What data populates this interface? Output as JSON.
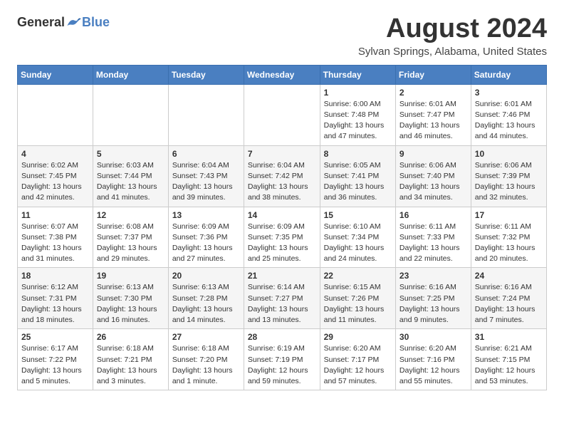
{
  "header": {
    "logo_general": "General",
    "logo_blue": "Blue",
    "month_title": "August 2024",
    "location": "Sylvan Springs, Alabama, United States"
  },
  "days_of_week": [
    "Sunday",
    "Monday",
    "Tuesday",
    "Wednesday",
    "Thursday",
    "Friday",
    "Saturday"
  ],
  "weeks": [
    [
      {
        "day": "",
        "info": ""
      },
      {
        "day": "",
        "info": ""
      },
      {
        "day": "",
        "info": ""
      },
      {
        "day": "",
        "info": ""
      },
      {
        "day": "1",
        "info": "Sunrise: 6:00 AM\nSunset: 7:48 PM\nDaylight: 13 hours\nand 47 minutes."
      },
      {
        "day": "2",
        "info": "Sunrise: 6:01 AM\nSunset: 7:47 PM\nDaylight: 13 hours\nand 46 minutes."
      },
      {
        "day": "3",
        "info": "Sunrise: 6:01 AM\nSunset: 7:46 PM\nDaylight: 13 hours\nand 44 minutes."
      }
    ],
    [
      {
        "day": "4",
        "info": "Sunrise: 6:02 AM\nSunset: 7:45 PM\nDaylight: 13 hours\nand 42 minutes."
      },
      {
        "day": "5",
        "info": "Sunrise: 6:03 AM\nSunset: 7:44 PM\nDaylight: 13 hours\nand 41 minutes."
      },
      {
        "day": "6",
        "info": "Sunrise: 6:04 AM\nSunset: 7:43 PM\nDaylight: 13 hours\nand 39 minutes."
      },
      {
        "day": "7",
        "info": "Sunrise: 6:04 AM\nSunset: 7:42 PM\nDaylight: 13 hours\nand 38 minutes."
      },
      {
        "day": "8",
        "info": "Sunrise: 6:05 AM\nSunset: 7:41 PM\nDaylight: 13 hours\nand 36 minutes."
      },
      {
        "day": "9",
        "info": "Sunrise: 6:06 AM\nSunset: 7:40 PM\nDaylight: 13 hours\nand 34 minutes."
      },
      {
        "day": "10",
        "info": "Sunrise: 6:06 AM\nSunset: 7:39 PM\nDaylight: 13 hours\nand 32 minutes."
      }
    ],
    [
      {
        "day": "11",
        "info": "Sunrise: 6:07 AM\nSunset: 7:38 PM\nDaylight: 13 hours\nand 31 minutes."
      },
      {
        "day": "12",
        "info": "Sunrise: 6:08 AM\nSunset: 7:37 PM\nDaylight: 13 hours\nand 29 minutes."
      },
      {
        "day": "13",
        "info": "Sunrise: 6:09 AM\nSunset: 7:36 PM\nDaylight: 13 hours\nand 27 minutes."
      },
      {
        "day": "14",
        "info": "Sunrise: 6:09 AM\nSunset: 7:35 PM\nDaylight: 13 hours\nand 25 minutes."
      },
      {
        "day": "15",
        "info": "Sunrise: 6:10 AM\nSunset: 7:34 PM\nDaylight: 13 hours\nand 24 minutes."
      },
      {
        "day": "16",
        "info": "Sunrise: 6:11 AM\nSunset: 7:33 PM\nDaylight: 13 hours\nand 22 minutes."
      },
      {
        "day": "17",
        "info": "Sunrise: 6:11 AM\nSunset: 7:32 PM\nDaylight: 13 hours\nand 20 minutes."
      }
    ],
    [
      {
        "day": "18",
        "info": "Sunrise: 6:12 AM\nSunset: 7:31 PM\nDaylight: 13 hours\nand 18 minutes."
      },
      {
        "day": "19",
        "info": "Sunrise: 6:13 AM\nSunset: 7:30 PM\nDaylight: 13 hours\nand 16 minutes."
      },
      {
        "day": "20",
        "info": "Sunrise: 6:13 AM\nSunset: 7:28 PM\nDaylight: 13 hours\nand 14 minutes."
      },
      {
        "day": "21",
        "info": "Sunrise: 6:14 AM\nSunset: 7:27 PM\nDaylight: 13 hours\nand 13 minutes."
      },
      {
        "day": "22",
        "info": "Sunrise: 6:15 AM\nSunset: 7:26 PM\nDaylight: 13 hours\nand 11 minutes."
      },
      {
        "day": "23",
        "info": "Sunrise: 6:16 AM\nSunset: 7:25 PM\nDaylight: 13 hours\nand 9 minutes."
      },
      {
        "day": "24",
        "info": "Sunrise: 6:16 AM\nSunset: 7:24 PM\nDaylight: 13 hours\nand 7 minutes."
      }
    ],
    [
      {
        "day": "25",
        "info": "Sunrise: 6:17 AM\nSunset: 7:22 PM\nDaylight: 13 hours\nand 5 minutes."
      },
      {
        "day": "26",
        "info": "Sunrise: 6:18 AM\nSunset: 7:21 PM\nDaylight: 13 hours\nand 3 minutes."
      },
      {
        "day": "27",
        "info": "Sunrise: 6:18 AM\nSunset: 7:20 PM\nDaylight: 13 hours\nand 1 minute."
      },
      {
        "day": "28",
        "info": "Sunrise: 6:19 AM\nSunset: 7:19 PM\nDaylight: 12 hours\nand 59 minutes."
      },
      {
        "day": "29",
        "info": "Sunrise: 6:20 AM\nSunset: 7:17 PM\nDaylight: 12 hours\nand 57 minutes."
      },
      {
        "day": "30",
        "info": "Sunrise: 6:20 AM\nSunset: 7:16 PM\nDaylight: 12 hours\nand 55 minutes."
      },
      {
        "day": "31",
        "info": "Sunrise: 6:21 AM\nSunset: 7:15 PM\nDaylight: 12 hours\nand 53 minutes."
      }
    ]
  ]
}
